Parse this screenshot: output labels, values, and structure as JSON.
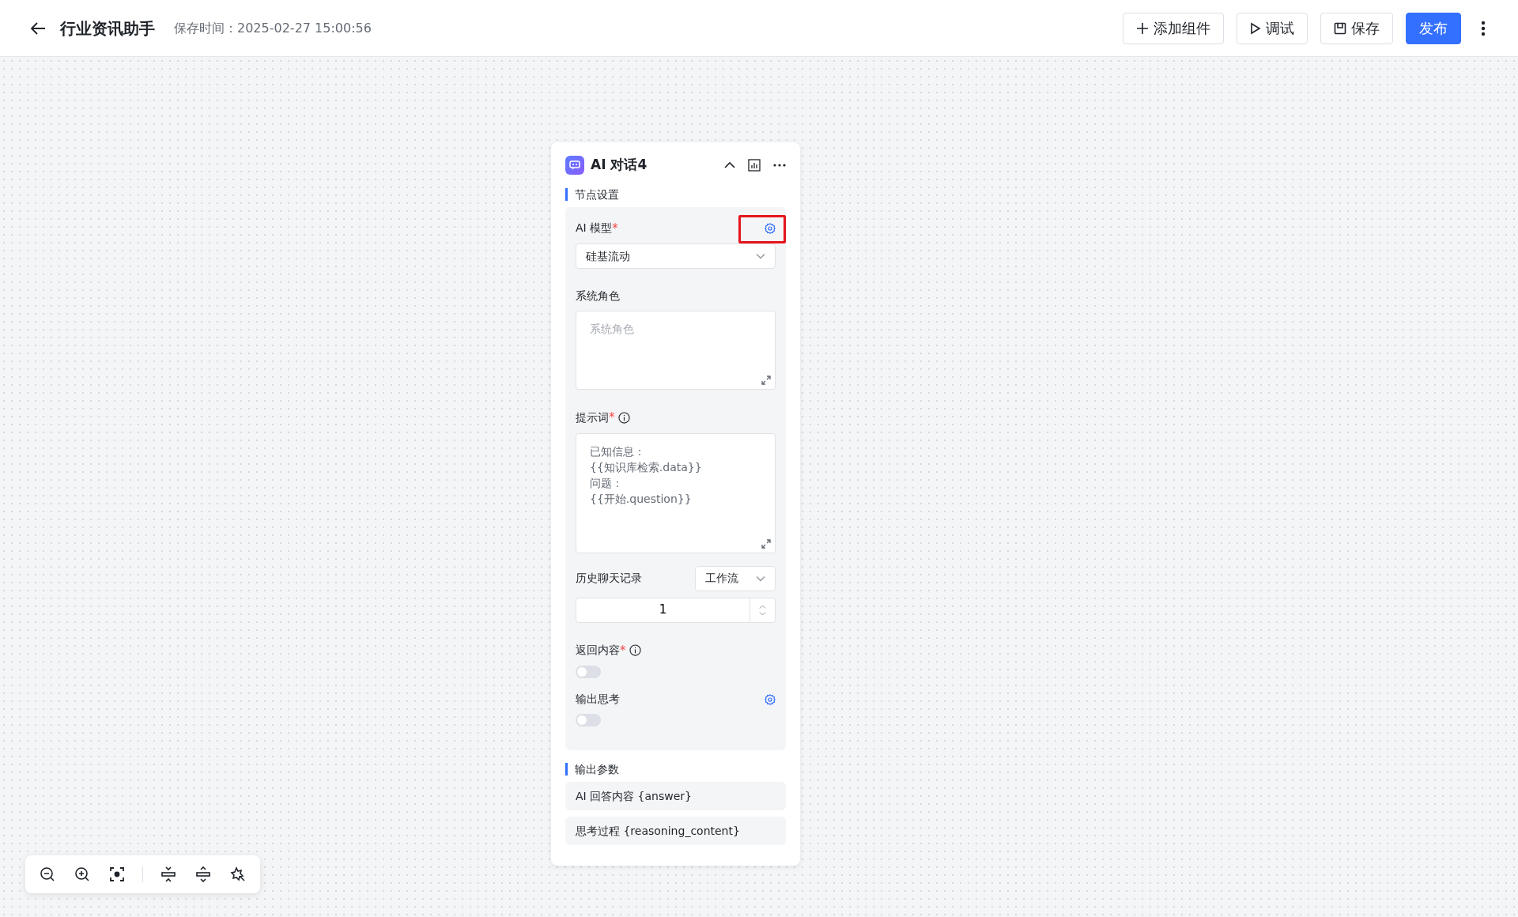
{
  "header": {
    "title": "行业资讯助手",
    "save_time": "保存时间：2025-02-27 15:00:56",
    "buttons": [
      {
        "kind": "add",
        "label": "添加组件"
      },
      {
        "kind": "debug",
        "label": "调试"
      },
      {
        "kind": "save",
        "label": "保存"
      },
      {
        "kind": "publish",
        "label": "发布"
      }
    ]
  },
  "node": {
    "title": "AI 对话4",
    "settings_heading": "节点设置",
    "model": {
      "label": "AI 模型",
      "required_mark": "*",
      "value": "硅基流动"
    },
    "system_role": {
      "label": "系统角色",
      "placeholder": "系统角色"
    },
    "prompt": {
      "label": "提示词",
      "required_mark": "*",
      "value": "已知信息：\n{{知识库检索.data}}\n问题：\n{{开始.question}}"
    },
    "history": {
      "label": "历史聊天记录",
      "source": "工作流",
      "count": "1"
    },
    "return_content": {
      "label": "返回内容",
      "required_mark": "*",
      "on": false
    },
    "output_thinking": {
      "label": "输出思考",
      "on": false
    },
    "output_heading": "输出参数",
    "outputs": [
      "AI 回答内容 {answer}",
      "思考过程 {reasoning_content}"
    ]
  }
}
